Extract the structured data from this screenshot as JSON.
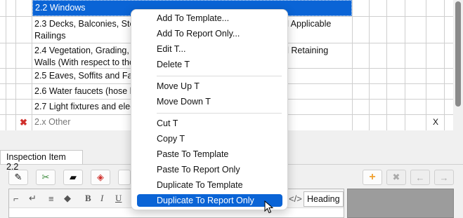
{
  "grid": {
    "rows": [
      {
        "label": "2.2 Windows",
        "selected": true
      },
      {
        "label": "2.3 Decks, Balconies, Stoo"
      },
      {
        "label": "nd Applicable"
      },
      {
        "label": "Railings"
      },
      {
        "label": "2.4 Vegetation, Grading, D"
      },
      {
        "label": "nd Retaining"
      },
      {
        "label": "Walls (With respect to the"
      },
      {
        "label": "2.5 Eaves, Soffits and Fasc"
      },
      {
        "label": "2.6 Water faucets (hose bi"
      },
      {
        "label": "2.7 Light fixtures and elect"
      },
      {
        "label": "2.x Other",
        "x_mark": "X"
      }
    ]
  },
  "tab": {
    "label": "Inspection Item 2.2"
  },
  "editor": {
    "heading_select": "Heading"
  },
  "context_menu": {
    "items": [
      {
        "label": "Add To Template..."
      },
      {
        "label": "Add To Report Only..."
      },
      {
        "label": "Edit T..."
      },
      {
        "label": "Delete T"
      },
      {
        "label": "Move Up T"
      },
      {
        "label": "Move Down T"
      },
      {
        "label": "Cut T"
      },
      {
        "label": "Copy T"
      },
      {
        "label": "Paste To Template"
      },
      {
        "label": "Paste To Report Only"
      },
      {
        "label": "Duplicate To Template"
      },
      {
        "label": "Duplicate To Report Only",
        "highlighted": true
      }
    ]
  },
  "colors": {
    "selection": "#0a64d6",
    "delete_icon": "#d0312d",
    "add_icon": "#f0a030"
  }
}
